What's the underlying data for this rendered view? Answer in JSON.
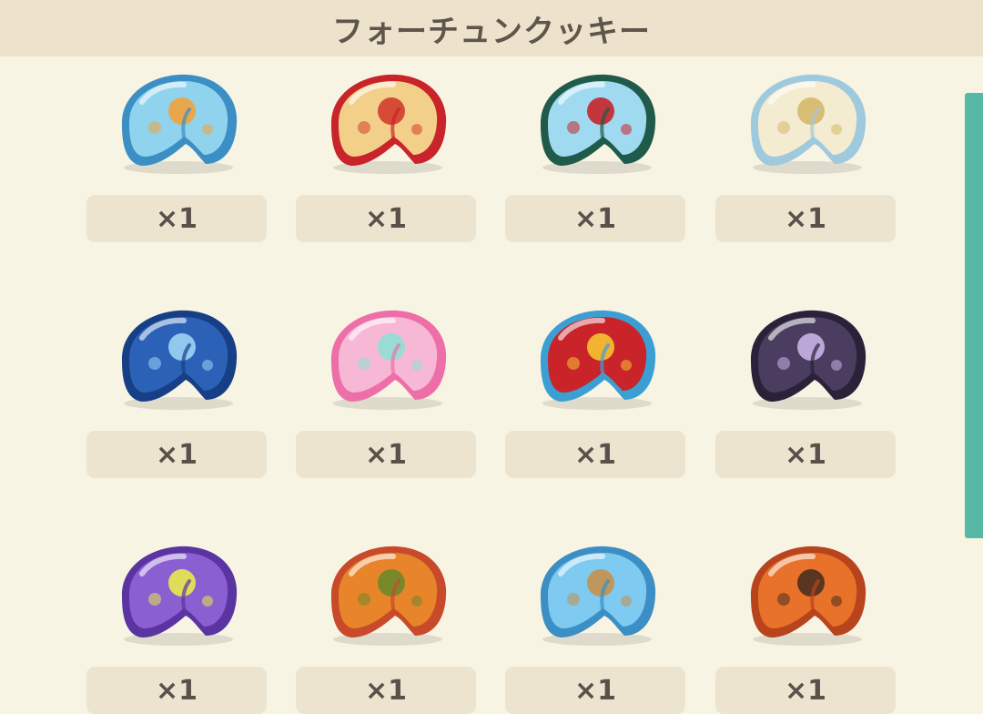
{
  "header": {
    "title": "フォーチュンクッキー"
  },
  "cookies": [
    {
      "icon": "beach-cookie-icon",
      "count": "×1",
      "colors": {
        "shell": "#8fd3ee",
        "edge": "#3c8fc4",
        "accent": "#f2a23a"
      }
    },
    {
      "icon": "pizza-cookie-icon",
      "count": "×1",
      "colors": {
        "shell": "#f3d08a",
        "edge": "#c8242a",
        "accent": "#d43c2c"
      }
    },
    {
      "icon": "torii-cookie-icon",
      "count": "×1",
      "colors": {
        "shell": "#9fdaf0",
        "edge": "#1f5a4a",
        "accent": "#c8242a"
      }
    },
    {
      "icon": "golden-cloud-cookie-icon",
      "count": "×1",
      "colors": {
        "shell": "#f4ecd0",
        "edge": "#9fc9dc",
        "accent": "#d6b86a"
      }
    },
    {
      "icon": "whale-cookie-icon",
      "count": "×1",
      "colors": {
        "shell": "#2b62b8",
        "edge": "#173f86",
        "accent": "#9fd4f4"
      }
    },
    {
      "icon": "pastel-peach-cookie-icon",
      "count": "×1",
      "colors": {
        "shell": "#f7b8d6",
        "edge": "#ee6fa8",
        "accent": "#8ee0d4"
      }
    },
    {
      "icon": "star-cookie-icon",
      "count": "×1",
      "colors": {
        "shell": "#c8242a",
        "edge": "#3c9fd4",
        "accent": "#f6c431"
      }
    },
    {
      "icon": "lily-cookie-icon",
      "count": "×1",
      "colors": {
        "shell": "#4a3d60",
        "edge": "#2b2239",
        "accent": "#c9b4e6"
      }
    },
    {
      "icon": "bat-cookie-icon",
      "count": "×1",
      "colors": {
        "shell": "#8a5fd2",
        "edge": "#5a34a0",
        "accent": "#e7ea4a"
      }
    },
    {
      "icon": "acorn-cookie-icon",
      "count": "×1",
      "colors": {
        "shell": "#e8842a",
        "edge": "#c84a2a",
        "accent": "#6d8a2a"
      }
    },
    {
      "icon": "gear-cookie-icon",
      "count": "×1",
      "colors": {
        "shell": "#7ecaf0",
        "edge": "#3c8fc4",
        "accent": "#c7904a"
      }
    },
    {
      "icon": "cinema-cookie-icon",
      "count": "×1",
      "colors": {
        "shell": "#e8722a",
        "edge": "#b8441e",
        "accent": "#4a3020"
      }
    }
  ],
  "scrollbar": {
    "color": "#58b8a6"
  },
  "theme": {
    "background": "#f8f4e4",
    "header_bg": "#ede3cc",
    "badge_bg": "#ede4d0",
    "text": "#5a514a"
  }
}
